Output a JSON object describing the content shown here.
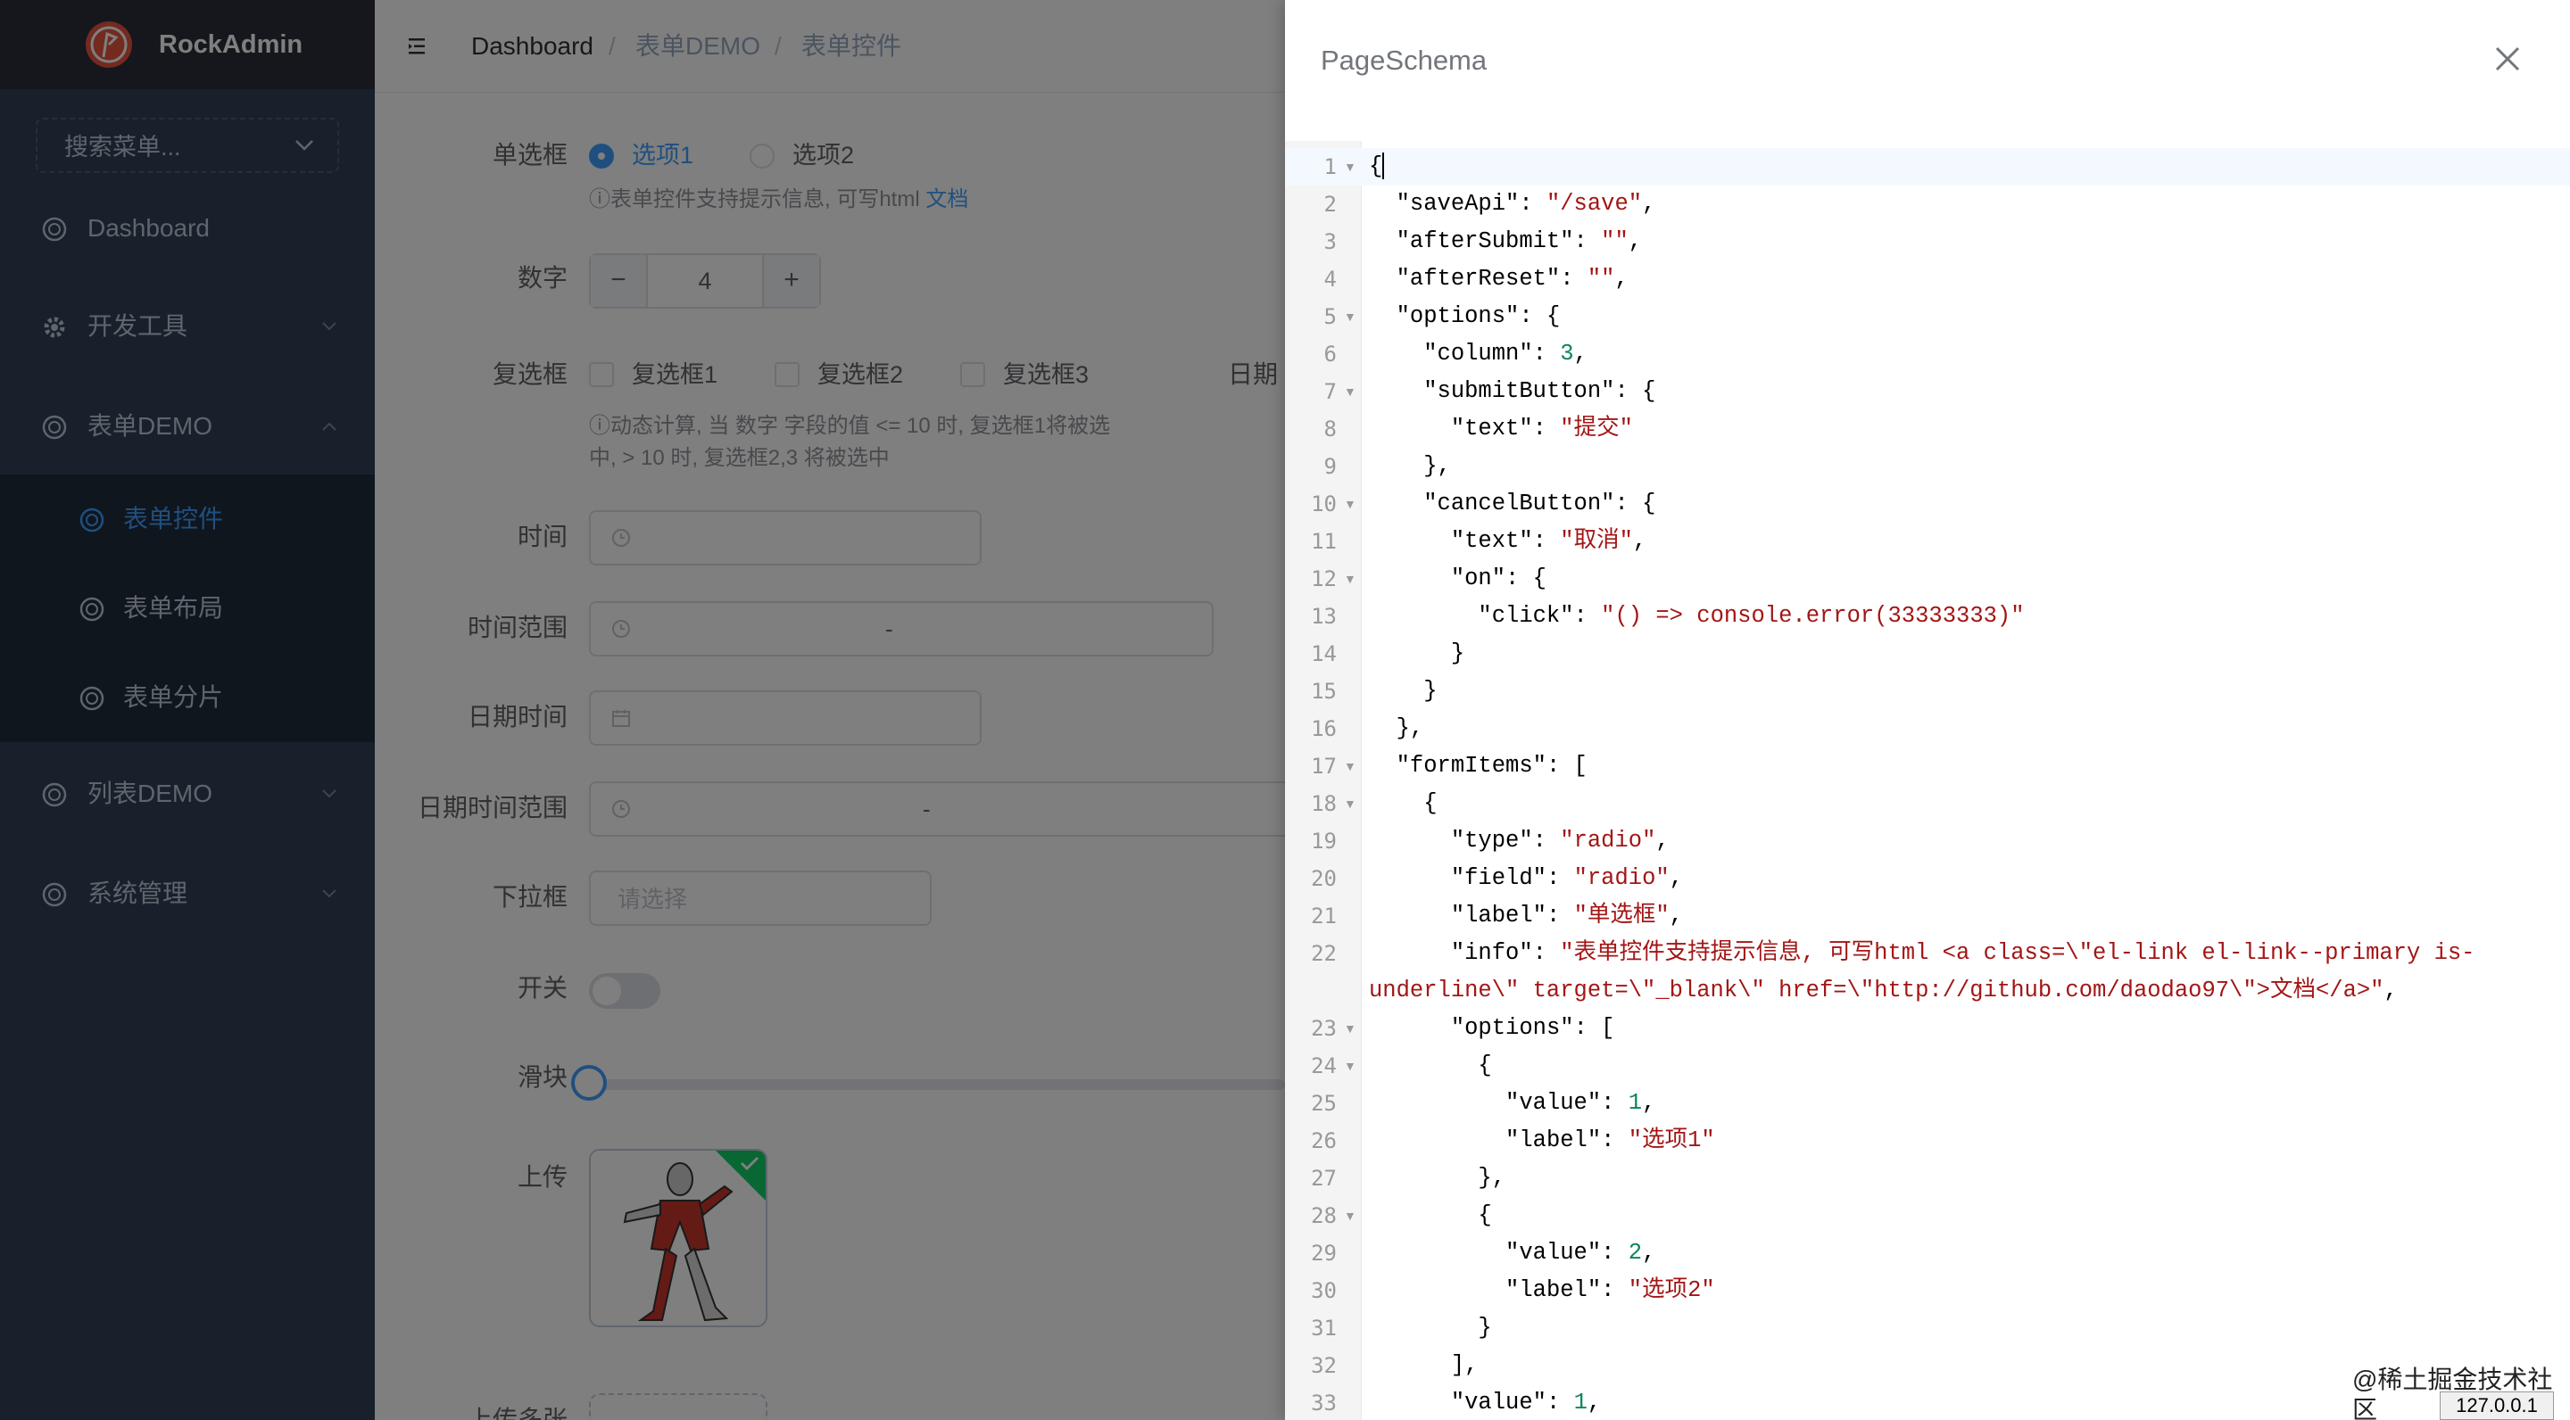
{
  "sidebar": {
    "brand": "RockAdmin",
    "search_placeholder": "搜索菜单...",
    "items": [
      {
        "label": "Dashboard",
        "icon": "circle-icon"
      },
      {
        "label": "开发工具",
        "icon": "gear-icon"
      },
      {
        "label": "表单DEMO",
        "icon": "circle-icon"
      },
      {
        "label": "列表DEMO",
        "icon": "circle-icon"
      },
      {
        "label": "系统管理",
        "icon": "circle-icon"
      }
    ],
    "sub_items": [
      {
        "label": "表单控件",
        "active": true
      },
      {
        "label": "表单布局"
      },
      {
        "label": "表单分片"
      }
    ]
  },
  "header": {
    "breadcrumb": [
      "Dashboard",
      "表单DEMO",
      "表单控件"
    ],
    "separator": "/"
  },
  "form": {
    "radio_label": "单选框",
    "radio_options": [
      "选项1",
      "选项2"
    ],
    "radio_info": "ⓘ表单控件支持提示信息, 可写html",
    "radio_info_link": "文档",
    "number_label": "数字",
    "number_value": "4",
    "number_minus": "−",
    "number_plus": "+",
    "checkbox_label": "复选框",
    "checkbox_options": [
      "复选框1",
      "复选框2",
      "复选框3"
    ],
    "checkbox_info_1": "ⓘ动态计算, 当 数字 字段的值 <= 10 时, 复选框1将被选",
    "checkbox_info_2": "中, > 10 时, 复选框2,3 将被选中",
    "date_label": "日期",
    "time_label": "时间",
    "time_range_label": "时间范围",
    "datetime_label": "日期时间",
    "datetime_range_label": "日期时间范围",
    "range_dash": "-",
    "select_label": "下拉框",
    "select_placeholder": "请选择",
    "switch_label": "开关",
    "slider_label": "滑块",
    "upload_label": "上传",
    "upload_multi_label": "上传多张"
  },
  "drawer": {
    "title": "PageSchema",
    "close_icon": "close-icon"
  },
  "editor": {
    "lines": [
      {
        "n": "1",
        "fold": true,
        "tokens": [
          [
            "p",
            "{"
          ]
        ]
      },
      {
        "n": "2",
        "tokens": [
          [
            "p",
            "  "
          ],
          [
            "k",
            "\"saveApi\""
          ],
          [
            "p",
            ": "
          ],
          [
            "s",
            "\"/save\""
          ],
          [
            "p",
            ","
          ]
        ]
      },
      {
        "n": "3",
        "tokens": [
          [
            "p",
            "  "
          ],
          [
            "k",
            "\"afterSubmit\""
          ],
          [
            "p",
            ": "
          ],
          [
            "s",
            "\"\""
          ],
          [
            "p",
            ","
          ]
        ]
      },
      {
        "n": "4",
        "tokens": [
          [
            "p",
            "  "
          ],
          [
            "k",
            "\"afterReset\""
          ],
          [
            "p",
            ": "
          ],
          [
            "s",
            "\"\""
          ],
          [
            "p",
            ","
          ]
        ]
      },
      {
        "n": "5",
        "fold": true,
        "tokens": [
          [
            "p",
            "  "
          ],
          [
            "k",
            "\"options\""
          ],
          [
            "p",
            ": {"
          ]
        ]
      },
      {
        "n": "6",
        "tokens": [
          [
            "p",
            "    "
          ],
          [
            "k",
            "\"column\""
          ],
          [
            "p",
            ": "
          ],
          [
            "n",
            "3"
          ],
          [
            "p",
            ","
          ]
        ]
      },
      {
        "n": "7",
        "fold": true,
        "tokens": [
          [
            "p",
            "    "
          ],
          [
            "k",
            "\"submitButton\""
          ],
          [
            "p",
            ": {"
          ]
        ]
      },
      {
        "n": "8",
        "tokens": [
          [
            "p",
            "      "
          ],
          [
            "k",
            "\"text\""
          ],
          [
            "p",
            ": "
          ],
          [
            "s",
            "\"提交\""
          ]
        ]
      },
      {
        "n": "9",
        "tokens": [
          [
            "p",
            "    },"
          ]
        ]
      },
      {
        "n": "10",
        "fold": true,
        "tokens": [
          [
            "p",
            "    "
          ],
          [
            "k",
            "\"cancelButton\""
          ],
          [
            "p",
            ": {"
          ]
        ]
      },
      {
        "n": "11",
        "tokens": [
          [
            "p",
            "      "
          ],
          [
            "k",
            "\"text\""
          ],
          [
            "p",
            ": "
          ],
          [
            "s",
            "\"取消\""
          ],
          [
            "p",
            ","
          ]
        ]
      },
      {
        "n": "12",
        "fold": true,
        "tokens": [
          [
            "p",
            "      "
          ],
          [
            "k",
            "\"on\""
          ],
          [
            "p",
            ": {"
          ]
        ]
      },
      {
        "n": "13",
        "tokens": [
          [
            "p",
            "        "
          ],
          [
            "k",
            "\"click\""
          ],
          [
            "p",
            ": "
          ],
          [
            "s",
            "\"() => console.error(33333333)\""
          ]
        ]
      },
      {
        "n": "14",
        "tokens": [
          [
            "p",
            "      }"
          ]
        ]
      },
      {
        "n": "15",
        "tokens": [
          [
            "p",
            "    }"
          ]
        ]
      },
      {
        "n": "16",
        "tokens": [
          [
            "p",
            "  },"
          ]
        ]
      },
      {
        "n": "17",
        "fold": true,
        "tokens": [
          [
            "p",
            "  "
          ],
          [
            "k",
            "\"formItems\""
          ],
          [
            "p",
            ": ["
          ]
        ]
      },
      {
        "n": "18",
        "fold": true,
        "tokens": [
          [
            "p",
            "    {"
          ]
        ]
      },
      {
        "n": "19",
        "tokens": [
          [
            "p",
            "      "
          ],
          [
            "k",
            "\"type\""
          ],
          [
            "p",
            ": "
          ],
          [
            "s",
            "\"radio\""
          ],
          [
            "p",
            ","
          ]
        ]
      },
      {
        "n": "20",
        "tokens": [
          [
            "p",
            "      "
          ],
          [
            "k",
            "\"field\""
          ],
          [
            "p",
            ": "
          ],
          [
            "s",
            "\"radio\""
          ],
          [
            "p",
            ","
          ]
        ]
      },
      {
        "n": "21",
        "tokens": [
          [
            "p",
            "      "
          ],
          [
            "k",
            "\"label\""
          ],
          [
            "p",
            ": "
          ],
          [
            "s",
            "\"单选框\""
          ],
          [
            "p",
            ","
          ]
        ]
      },
      {
        "n": "22",
        "tokens": [
          [
            "p",
            "      "
          ],
          [
            "k",
            "\"info\""
          ],
          [
            "p",
            ": "
          ],
          [
            "s",
            "\"表单控件支持提示信息, 可写html <a class=\\\"el-link el-link--primary is-"
          ]
        ]
      },
      {
        "n": "",
        "tokens": [
          [
            "s",
            "underline\\\" target=\\\"_blank\\\" href=\\\"http://github.com/daodao97\\\">文档</a>\""
          ],
          [
            "p",
            ","
          ]
        ]
      },
      {
        "n": "23",
        "fold": true,
        "tokens": [
          [
            "p",
            "      "
          ],
          [
            "k",
            "\"options\""
          ],
          [
            "p",
            ": ["
          ]
        ]
      },
      {
        "n": "24",
        "fold": true,
        "tokens": [
          [
            "p",
            "        {"
          ]
        ]
      },
      {
        "n": "25",
        "tokens": [
          [
            "p",
            "          "
          ],
          [
            "k",
            "\"value\""
          ],
          [
            "p",
            ": "
          ],
          [
            "n",
            "1"
          ],
          [
            "p",
            ","
          ]
        ]
      },
      {
        "n": "26",
        "tokens": [
          [
            "p",
            "          "
          ],
          [
            "k",
            "\"label\""
          ],
          [
            "p",
            ": "
          ],
          [
            "s",
            "\"选项1\""
          ]
        ]
      },
      {
        "n": "27",
        "tokens": [
          [
            "p",
            "        },"
          ]
        ]
      },
      {
        "n": "28",
        "fold": true,
        "tokens": [
          [
            "p",
            "        {"
          ]
        ]
      },
      {
        "n": "29",
        "tokens": [
          [
            "p",
            "          "
          ],
          [
            "k",
            "\"value\""
          ],
          [
            "p",
            ": "
          ],
          [
            "n",
            "2"
          ],
          [
            "p",
            ","
          ]
        ]
      },
      {
        "n": "30",
        "tokens": [
          [
            "p",
            "          "
          ],
          [
            "k",
            "\"label\""
          ],
          [
            "p",
            ": "
          ],
          [
            "s",
            "\"选项2\""
          ]
        ]
      },
      {
        "n": "31",
        "tokens": [
          [
            "p",
            "        }"
          ]
        ]
      },
      {
        "n": "32",
        "tokens": [
          [
            "p",
            "      ],"
          ]
        ]
      },
      {
        "n": "33",
        "tokens": [
          [
            "p",
            "      "
          ],
          [
            "k",
            "\"value\""
          ],
          [
            "p",
            ": "
          ],
          [
            "n",
            "1"
          ],
          [
            "p",
            ","
          ]
        ]
      }
    ]
  },
  "watermark": "@稀土掘金技术社区",
  "ip_badge": "127.0.0.1",
  "colors": {
    "sidebar_bg": "#304156",
    "submenu_bg": "#1f2d3d",
    "primary": "#409eff",
    "string_token": "#a31515",
    "number_token": "#098658"
  }
}
